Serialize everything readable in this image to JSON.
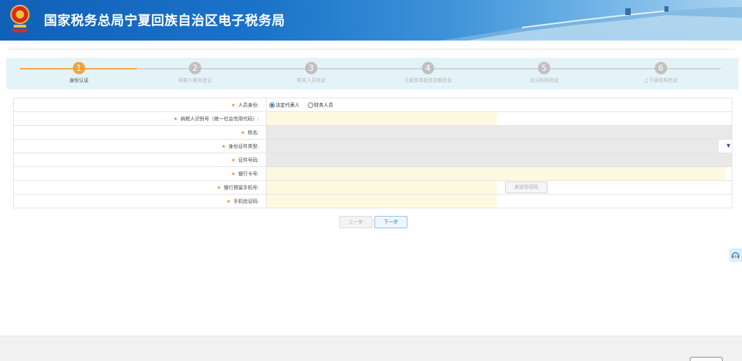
{
  "header": {
    "title": "国家税务总局宁夏回族自治区电子税务局",
    "colors": {
      "primary": "#1160b8",
      "emblem_red": "#d92b1c",
      "emblem_gold": "#f2c23a"
    }
  },
  "stepper": {
    "active_color": "#f5a243",
    "steps": [
      {
        "number": "1",
        "label": "身份认证"
      },
      {
        "number": "2",
        "label": "纳税人税务登记"
      },
      {
        "number": "3",
        "label": "相关人员信息"
      },
      {
        "number": "4",
        "label": "注册资本投资总额信息"
      },
      {
        "number": "5",
        "label": "总分机构信息"
      },
      {
        "number": "6",
        "label": "上下级机构信息"
      }
    ]
  },
  "form": {
    "required_mark": "★",
    "rows": {
      "identity": {
        "label": "人员身份:",
        "options": [
          {
            "label": "法定代表人",
            "selected": true
          },
          {
            "label": "财务人员",
            "selected": false
          }
        ]
      },
      "taxpayer_id": {
        "label": "纳税人识别号（统一社会信用代码）:"
      },
      "name": {
        "label": "姓名:"
      },
      "id_type": {
        "label": "身份证件类型:"
      },
      "id_number": {
        "label": "证件号码:"
      },
      "bank_card": {
        "label": "银行卡号:"
      },
      "bank_phone": {
        "label": "银行预留手机号:",
        "send_code_button": "发送验证码"
      },
      "sms_code": {
        "label": "手机验证码:"
      }
    }
  },
  "actions": {
    "prev": "上一步",
    "next": "下一步"
  },
  "icons": {
    "emblem": "tax-emblem-icon",
    "service": "customer-service-icon",
    "dropdown": "caret-down-icon"
  }
}
